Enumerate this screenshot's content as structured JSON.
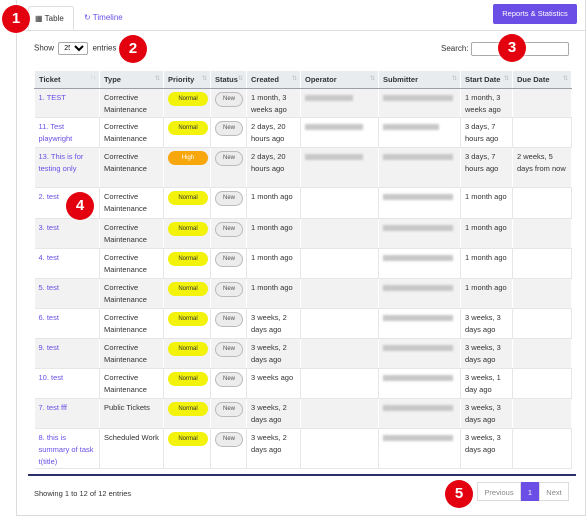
{
  "tabs": [
    {
      "label": "Table",
      "icon": "table-icon"
    },
    {
      "label": "Timeline",
      "icon": "timeline-icon"
    }
  ],
  "reports_button": "Reports & Statistics",
  "length": {
    "prefix": "Show",
    "value": "25",
    "suffix": "entries"
  },
  "search": {
    "label": "Search:",
    "value": ""
  },
  "columns": [
    "Ticket",
    "Type",
    "Priority",
    "Status",
    "Created",
    "Operator",
    "Submitter",
    "Start Date",
    "Due Date"
  ],
  "rows": [
    {
      "ticket": "1. TEST",
      "type": "Corrective Maintenance",
      "priority": "Normal",
      "status": "New",
      "created": "1 month, 3 weeks ago",
      "start": "1 month, 3 weeks ago",
      "due": ""
    },
    {
      "ticket": "11. Test playwright",
      "type": "Corrective Maintenance",
      "priority": "Normal",
      "status": "New",
      "created": "2 days, 20 hours ago",
      "start": "3 days, 7 hours ago",
      "due": ""
    },
    {
      "ticket": "13. This is for testing only",
      "type": "Corrective Maintenance",
      "priority": "High",
      "status": "New",
      "created": "2 days, 20 hours ago",
      "start": "3 days, 7 hours ago",
      "due": "2 weeks, 5 days from now"
    },
    {
      "ticket": "2. test",
      "type": "Corrective Maintenance",
      "priority": "Normal",
      "status": "New",
      "created": "1 month ago",
      "start": "1 month ago",
      "due": ""
    },
    {
      "ticket": "3. test",
      "type": "Corrective Maintenance",
      "priority": "Normal",
      "status": "New",
      "created": "1 month ago",
      "start": "1 month ago",
      "due": ""
    },
    {
      "ticket": "4. test",
      "type": "Corrective Maintenance",
      "priority": "Normal",
      "status": "New",
      "created": "1 month ago",
      "start": "1 month ago",
      "due": ""
    },
    {
      "ticket": "5. test",
      "type": "Corrective Maintenance",
      "priority": "Normal",
      "status": "New",
      "created": "1 month ago",
      "start": "1 month ago",
      "due": ""
    },
    {
      "ticket": "6. test",
      "type": "Corrective Maintenance",
      "priority": "Normal",
      "status": "New",
      "created": "3 weeks, 2 days ago",
      "start": "3 weeks, 3 days ago",
      "due": ""
    },
    {
      "ticket": "9. test",
      "type": "Corrective Maintenance",
      "priority": "Normal",
      "status": "New",
      "created": "3 weeks, 2 days ago",
      "start": "3 weeks, 3 days ago",
      "due": ""
    },
    {
      "ticket": "10. test",
      "type": "Corrective Maintenance",
      "priority": "Normal",
      "status": "New",
      "created": "3 weeks ago",
      "start": "3 weeks, 1 day ago",
      "due": ""
    },
    {
      "ticket": "7. test fff",
      "type": "Public Tickets",
      "priority": "Normal",
      "status": "New",
      "created": "3 weeks, 2 days ago",
      "start": "3 weeks, 3 days ago",
      "due": ""
    },
    {
      "ticket": "8. this is summary of task t(title)",
      "type": "Scheduled Work",
      "priority": "Normal",
      "status": "New",
      "created": "3 weeks, 2 days ago",
      "start": "3 weeks, 3 days ago",
      "due": ""
    }
  ],
  "info": "Showing 1 to 12 of 12 entries",
  "pager": {
    "prev": "Previous",
    "current": "1",
    "next": "Next"
  },
  "markers": [
    "1",
    "2",
    "3",
    "4",
    "5"
  ],
  "colors": {
    "accent": "#6b4ee6",
    "normal": "#f2f20a",
    "high": "#f7a70c",
    "marker": "#e3000f"
  }
}
